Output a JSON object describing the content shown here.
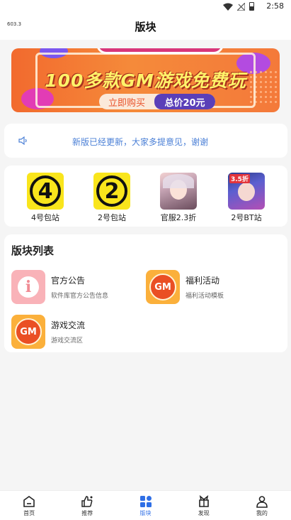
{
  "status_bar": {
    "time": "2:58"
  },
  "header": {
    "speed": "603.3",
    "title": "版块"
  },
  "banner": {
    "headline": "100多款GM游戏免费玩",
    "buy_label": "立即购买",
    "price_label": "总价20元"
  },
  "notice": {
    "text": "新版已经更新，大家多提意见，谢谢"
  },
  "quick_links": [
    {
      "label": "4号包站",
      "glyph": "4"
    },
    {
      "label": "2号包站",
      "glyph": "2"
    },
    {
      "label": "官服2.3折"
    },
    {
      "label": "2号BT站",
      "tag": "3.5折"
    }
  ],
  "section": {
    "title": "版块列表",
    "forums": [
      {
        "name": "官方公告",
        "desc": "软件库官方公告信息",
        "icon": "info-icon"
      },
      {
        "name": "福利活动",
        "desc": "福利活动模板",
        "icon": "gm-logo-icon",
        "logo_text": "GM"
      },
      {
        "name": "游戏交流",
        "desc": "游戏交流区",
        "icon": "gm-logo-icon",
        "logo_text": "GM"
      }
    ]
  },
  "tabbar": {
    "tabs": [
      {
        "label": "首页",
        "icon": "home-icon"
      },
      {
        "label": "推荐",
        "icon": "thumbs-up-icon"
      },
      {
        "label": "版块",
        "icon": "grid-icon",
        "active": true
      },
      {
        "label": "发现",
        "icon": "gift-icon"
      },
      {
        "label": "我的",
        "icon": "user-icon"
      }
    ]
  },
  "colors": {
    "accent": "#2f6fe6",
    "notice_text": "#4a7fd6",
    "banner_orange": "#f26a2e"
  }
}
